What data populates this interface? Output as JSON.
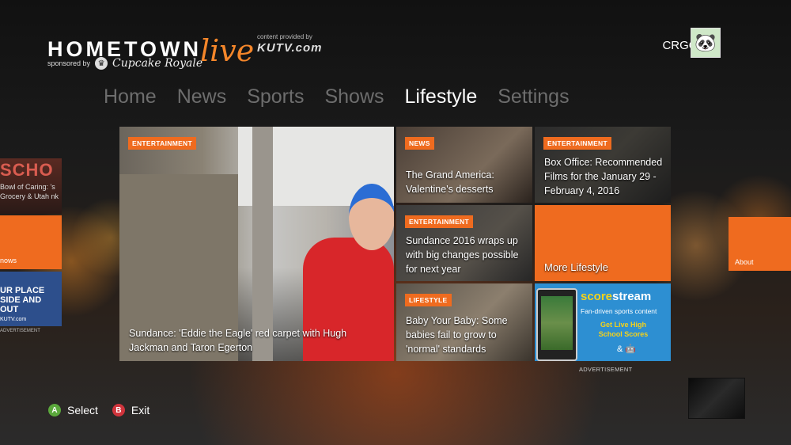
{
  "header": {
    "logo_main": "HOMETOWN",
    "logo_live": "live",
    "content_provided_by": "content provided by",
    "provider": "KUTV.com",
    "sponsored_by": "sponsored by",
    "sponsor_name": "Cupcake Royale",
    "username": "CRGOLD2"
  },
  "nav": {
    "items": [
      {
        "label": "Home"
      },
      {
        "label": "News"
      },
      {
        "label": "Sports"
      },
      {
        "label": "Shows"
      },
      {
        "label": "Lifestyle"
      },
      {
        "label": "Settings"
      }
    ],
    "active": "Lifestyle"
  },
  "tiles": {
    "featured": {
      "tag": "ENTERTAINMENT",
      "caption": "Sundance: 'Eddie the Eagle' red carpet with Hugh Jackman and Taron Egerton"
    },
    "grand_america": {
      "tag": "NEWS",
      "caption": "The Grand America: Valentine's desserts"
    },
    "box_office": {
      "tag": "ENTERTAINMENT",
      "caption": "Box Office: Recommended Films for the January 29 - February 4, 2016"
    },
    "sundance": {
      "tag": "ENTERTAINMENT",
      "caption": "Sundance 2016 wraps up with big changes possible for next year"
    },
    "more": {
      "caption": "More Lifestyle"
    },
    "baby": {
      "tag": "LIFESTYLE",
      "caption": "Baby Your Baby: Some babies fail to grow to 'normal' standards"
    },
    "ad": {
      "brand_a": "score",
      "brand_b": "stream",
      "tagline": "Fan-driven sports content",
      "cta_line1": "Get Live High",
      "cta_line2": "School Scores",
      "stores": "&",
      "label": "ADVERTISEMENT"
    }
  },
  "side_left": {
    "top_title": "SCHO",
    "top_text": "Bowl of Caring: 's Grocery & Utah nk",
    "mid_label": "nows",
    "bottom_text": "UR PLACE SIDE AND OUT",
    "bottom_brand": "KUTV.com",
    "adv_label": "ADVERTISEMENT"
  },
  "side_right": {
    "label": "About"
  },
  "controls": {
    "select_key": "A",
    "select_label": "Select",
    "exit_key": "B",
    "exit_label": "Exit"
  },
  "colors": {
    "accent": "#ef6b1f",
    "nav_inactive": "#6d6d6d",
    "nav_active": "#ffffff",
    "button_a": "#5ba83c",
    "button_b": "#d0343c",
    "ad_blue": "#2d8fd2",
    "ad_yellow": "#f5d21a"
  }
}
